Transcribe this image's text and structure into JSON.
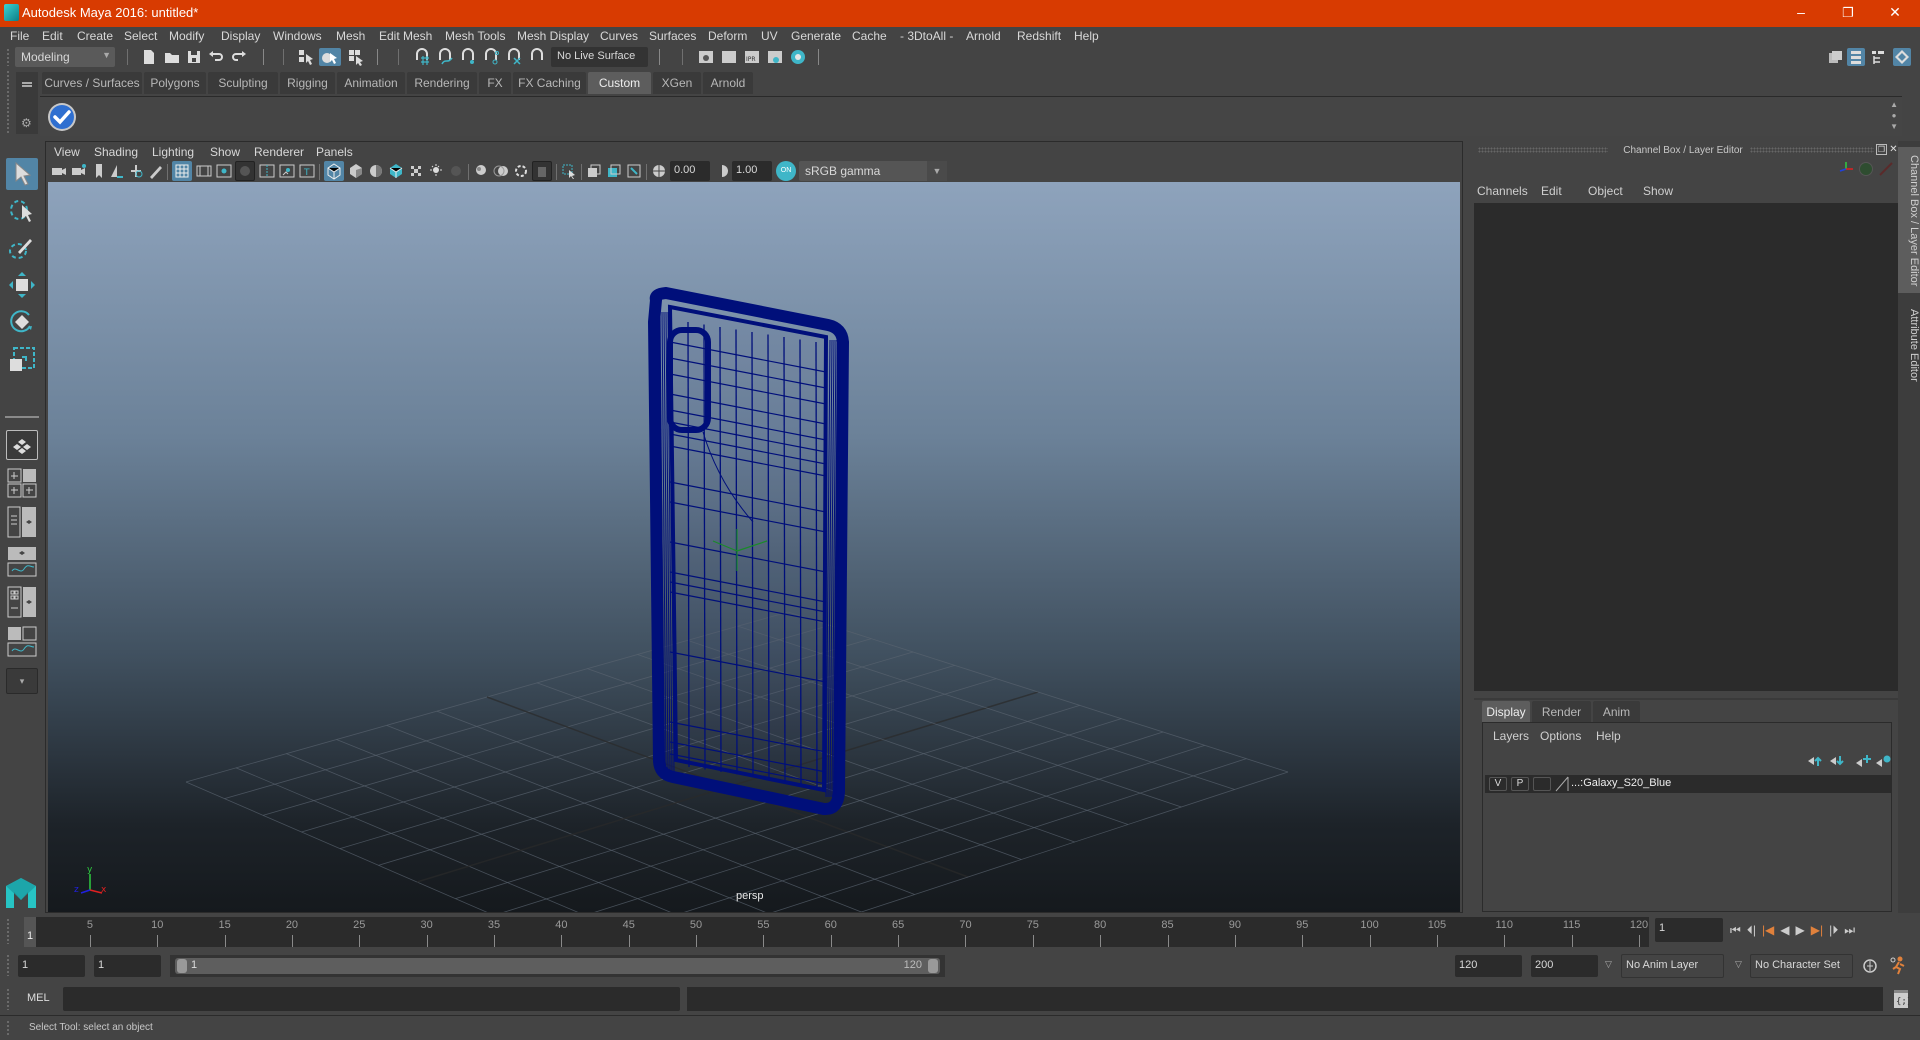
{
  "window": {
    "title": "Autodesk Maya 2016: untitled*",
    "controls": {
      "minimize": "–",
      "restore": "❐",
      "close": "✕"
    }
  },
  "menubar": {
    "items": [
      "File",
      "Edit",
      "Create",
      "Select",
      "Modify",
      "Display",
      "Windows",
      "Mesh",
      "Edit Mesh",
      "Mesh Tools",
      "Mesh Display",
      "Curves",
      "Surfaces",
      "Deform",
      "UV",
      "Generate",
      "Cache",
      "- 3DtoAll -",
      "Arnold",
      "Redshift",
      "Help"
    ]
  },
  "statusline": {
    "menuset": "Modeling",
    "live_surface": "No Live Surface"
  },
  "shelf": {
    "tabs": [
      "Curves / Surfaces",
      "Polygons",
      "Sculpting",
      "Rigging",
      "Animation",
      "Rendering",
      "FX",
      "FX Caching",
      "Custom",
      "XGen",
      "Arnold"
    ],
    "active_tab": "Custom",
    "items": [
      {
        "icon": "checkmark-icon"
      }
    ]
  },
  "toolbox": {
    "tools": [
      "select-tool",
      "lasso-tool",
      "paint-select-tool",
      "move-tool",
      "rotate-tool",
      "scale-tool"
    ],
    "active_tool": "select-tool",
    "layouts": [
      "single-perspective-layout",
      "four-view-layout",
      "persp-outliner-layout",
      "persp-graph-layout",
      "hypershade-persp-layout",
      "persp-graph-hypershade-layout"
    ]
  },
  "viewport": {
    "menu": [
      "View",
      "Shading",
      "Lighting",
      "Show",
      "Renderer",
      "Panels"
    ],
    "exposure": "0.00",
    "gamma": "1.00",
    "color_space": "sRGB gamma",
    "camera_label": "persp",
    "axis": {
      "x": "x",
      "y": "y",
      "z": "z"
    },
    "mesh_color": "#000f7a"
  },
  "channel_box": {
    "header": "Channel Box / Layer Editor",
    "menu": [
      "Channels",
      "Edit",
      "Object",
      "Show"
    ]
  },
  "layer_editor": {
    "tabs": [
      "Display",
      "Render",
      "Anim"
    ],
    "active_tab": "Display",
    "menu": [
      "Layers",
      "Options",
      "Help"
    ],
    "layers": [
      {
        "visible": "V",
        "playback": "P",
        "name": "...:Galaxy_S20_Blue"
      }
    ]
  },
  "side_tabs": [
    "Channel Box / Layer Editor",
    "Attribute Editor"
  ],
  "timeline": {
    "ticks": [
      5,
      10,
      15,
      20,
      25,
      30,
      35,
      40,
      45,
      50,
      55,
      60,
      65,
      70,
      75,
      80,
      85,
      90,
      95,
      100,
      105,
      110,
      115,
      120
    ],
    "current_frame_marker": "1",
    "current_frame": "1",
    "range_start": 1,
    "range_end": 120
  },
  "range_slider": {
    "start_time": "1",
    "playback_start": "1",
    "range_start_label": "1",
    "range_end_label": "120",
    "playback_end": "120",
    "end_time": "200",
    "anim_layer": "No Anim Layer",
    "character_set": "No Character Set"
  },
  "command_line": {
    "label": "MEL",
    "input": "",
    "output": ""
  },
  "help_line": {
    "text": "Select Tool: select an object"
  },
  "colors": {
    "titlebar": "#d83b01",
    "accent": "#5285a6",
    "accent_cyan": "#3fb6c8",
    "keyframe_orange": "#e0813c"
  }
}
